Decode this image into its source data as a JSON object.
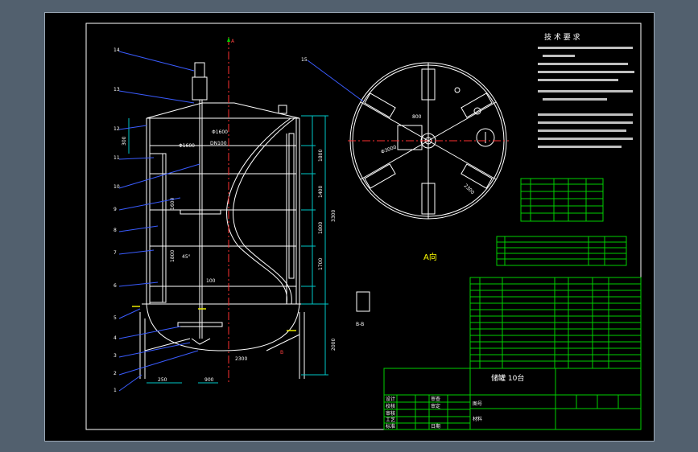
{
  "view_label": "A向",
  "section_label": "B-B",
  "section_marker": "B",
  "direction_marker": "A",
  "title_block": {
    "drawing_title": "储罐 10台",
    "scale_label": "图号",
    "material_label": "材料",
    "row_labels": [
      "设计",
      "校核",
      "审核",
      "工艺",
      "标准",
      "日期"
    ],
    "sign_labels": [
      "审查",
      "审定",
      "日期"
    ]
  },
  "tech_requirements": {
    "heading": "技 术 要 求"
  },
  "dimensions": {
    "tank_top": "Φ1600",
    "tank_inner": "Φ1600",
    "height_total": "3300",
    "height_shell": "2800",
    "segment_1": "1800",
    "segment_2": "1400",
    "segment_3": "1800",
    "segment_4": "1700",
    "bottom": "2000",
    "leg_width": "250",
    "leg_spacing": "900",
    "side_1": "1600",
    "side_2": "1800",
    "angle_1": "45°",
    "top_plan": "800",
    "plan_diameter": "Φ3000",
    "plan_side": "2300",
    "plan_bolt": "M16",
    "small_1": "100",
    "small_2": "300",
    "small_3": "2300",
    "pipe": "DN100"
  },
  "part_callouts": [
    "14",
    "13",
    "12",
    "11",
    "10",
    "9",
    "8",
    "7",
    "6",
    "5",
    "4",
    "3",
    "2",
    "1",
    "15"
  ],
  "colors": {
    "background": "#52606e",
    "sheet": "#000000",
    "outline": "#ffffff",
    "table": "#00d000",
    "centerline": "#ff3030",
    "leader": "#3a5cff",
    "dimension": "#00c8c8",
    "hatch": "#c800c8",
    "highlight": "#e8e800"
  }
}
